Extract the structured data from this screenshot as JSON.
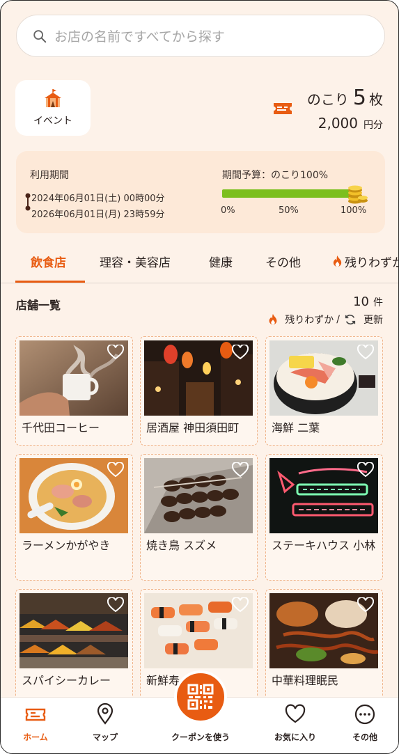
{
  "search": {
    "placeholder": "お店の名前ですべてから探す",
    "icon": "search-icon"
  },
  "event_button": {
    "label": "イベント",
    "icon": "circus-tent-icon"
  },
  "tickets": {
    "prefix": "のこり",
    "count": "5",
    "unit": "枚",
    "price": "2,000",
    "price_unit": "円分",
    "icon": "ticket-icon"
  },
  "period": {
    "title": "利用期間",
    "start": "2024年06月01日(土) 00時00分",
    "end": "2026年06月01日(月) 23時59分",
    "budget_label": "期間予算：のこり100%",
    "budget_fraction": 1.0,
    "ticks": [
      "0%",
      "50%",
      "100%"
    ]
  },
  "tabs": [
    {
      "label": "飲食店",
      "active": true
    },
    {
      "label": "理容・美容店"
    },
    {
      "label": "健康"
    },
    {
      "label": "その他"
    },
    {
      "label": "残りわずか",
      "icon": "fire-icon"
    }
  ],
  "list": {
    "title": "店舗一覧",
    "count": "10",
    "count_unit": "件",
    "filter_label": "残りわずか",
    "filter_sep": "/",
    "refresh_label": "更新"
  },
  "stores": [
    {
      "name": "千代田コーヒー",
      "photo": "coffee-photo"
    },
    {
      "name": "居酒屋 神田須田町",
      "photo": "izakaya-alley-photo"
    },
    {
      "name": "海鮮 二葉",
      "photo": "seafood-bowl-photo"
    },
    {
      "name": "ラーメンかがやき",
      "photo": "ramen-photo"
    },
    {
      "name": "焼き鳥 スズメ",
      "photo": "yakitori-photo"
    },
    {
      "name": "ステーキハウス 小林",
      "photo": "neon-sign-photo"
    },
    {
      "name": "スパイシーカレー",
      "photo": "spice-market-photo"
    },
    {
      "name": "新鮮寿",
      "photo": "sushi-photo"
    },
    {
      "name": "中華料理眠民",
      "photo": "chinese-food-photo"
    }
  ],
  "nav": {
    "home": "ホーム",
    "map": "マップ",
    "coupon": "クーポンを使う",
    "favorites": "お気に入り",
    "more": "その他"
  },
  "colors": {
    "accent": "#e85c12",
    "budget_bar": "#7cbf1e",
    "background": "#fdf2e9"
  }
}
